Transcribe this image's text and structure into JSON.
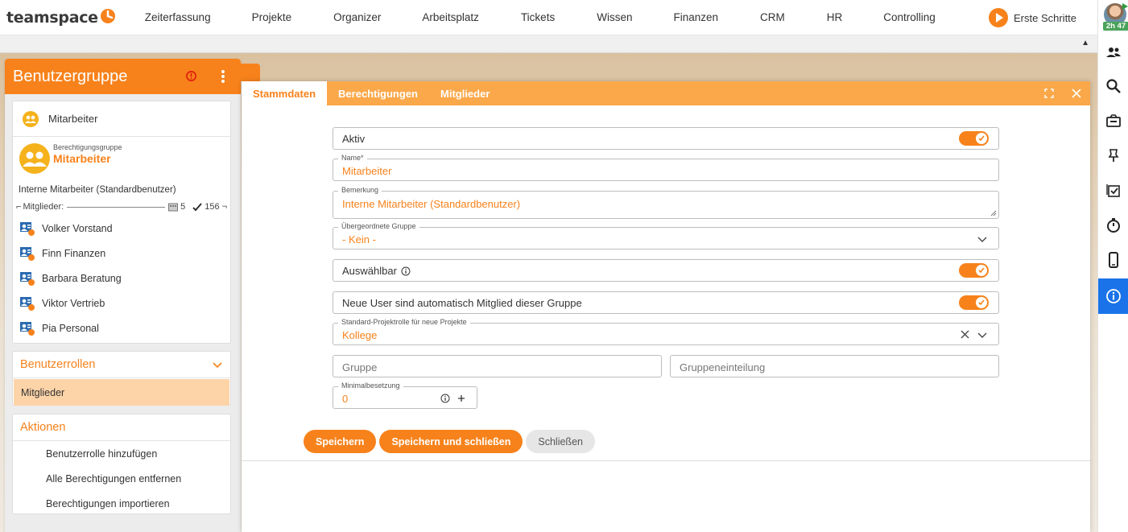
{
  "app": {
    "logo_text": "teamspace",
    "nav": [
      "Zeiterfassung",
      "Projekte",
      "Organizer",
      "Arbeitsplatz",
      "Tickets",
      "Wissen",
      "Finanzen",
      "CRM",
      "HR",
      "Controlling"
    ],
    "erste_schritte": "Erste Schritte",
    "timer_badge": "2h 47",
    "accent": "#f7821b",
    "active_blue": "#1a73e8"
  },
  "rightbar": {
    "icons": [
      "people-icon",
      "search-icon",
      "inbox-icon",
      "pin-icon",
      "tasks-icon",
      "stopwatch-icon",
      "mobile-icon",
      "info-icon"
    ]
  },
  "leftpanel": {
    "title": "Benutzergruppe",
    "group_label": "Mitarbeiter",
    "group_subtitle": "Berechtigungsgruppe",
    "group_name": "Mitarbeiter",
    "description": "Interne Mitarbeiter (Standardbenutzer)",
    "members_label": "Mitglieder:",
    "count_a": "5",
    "count_b": "156",
    "members": [
      "Volker Vorstand",
      "Finn Finanzen",
      "Barbara Beratung",
      "Viktor Vertrieb",
      "Pia Personal"
    ],
    "roles_title": "Benutzerrollen",
    "roles": [
      "Mitglieder"
    ],
    "actions_title": "Aktionen",
    "actions": [
      "Benutzerrolle hinzufügen",
      "Alle Berechtigungen entfernen",
      "Berechtigungen importieren"
    ]
  },
  "dialog": {
    "tabs": [
      "Stammdaten",
      "Berechtigungen",
      "Mitglieder"
    ],
    "active_tab": "Stammdaten",
    "fields": {
      "aktiv_label": "Aktiv",
      "aktiv_on": true,
      "name_label": "Name*",
      "name_value": "Mitarbeiter",
      "bemerkung_label": "Bemerkung",
      "bemerkung_value": "Interne Mitarbeiter (Standardbenutzer)",
      "parent_label": "Übergeordnete Gruppe",
      "parent_value": "- Kein -",
      "auswaehlbar_label": "Auswählbar",
      "auswaehlbar_on": true,
      "auto_member_label": "Neue User sind automatisch Mitglied dieser Gruppe",
      "auto_member_on": true,
      "projektrolle_label": "Standard-Projektrolle für neue Projekte",
      "projektrolle_value": "Kollege",
      "gruppe_placeholder": "Gruppe",
      "gruppeneinteilung_placeholder": "Gruppeneinteilung",
      "minimal_label": "Minimalbesetzung",
      "minimal_value": "0"
    },
    "buttons": {
      "save": "Speichern",
      "save_close": "Speichern und schließen",
      "close": "Schließen"
    }
  }
}
